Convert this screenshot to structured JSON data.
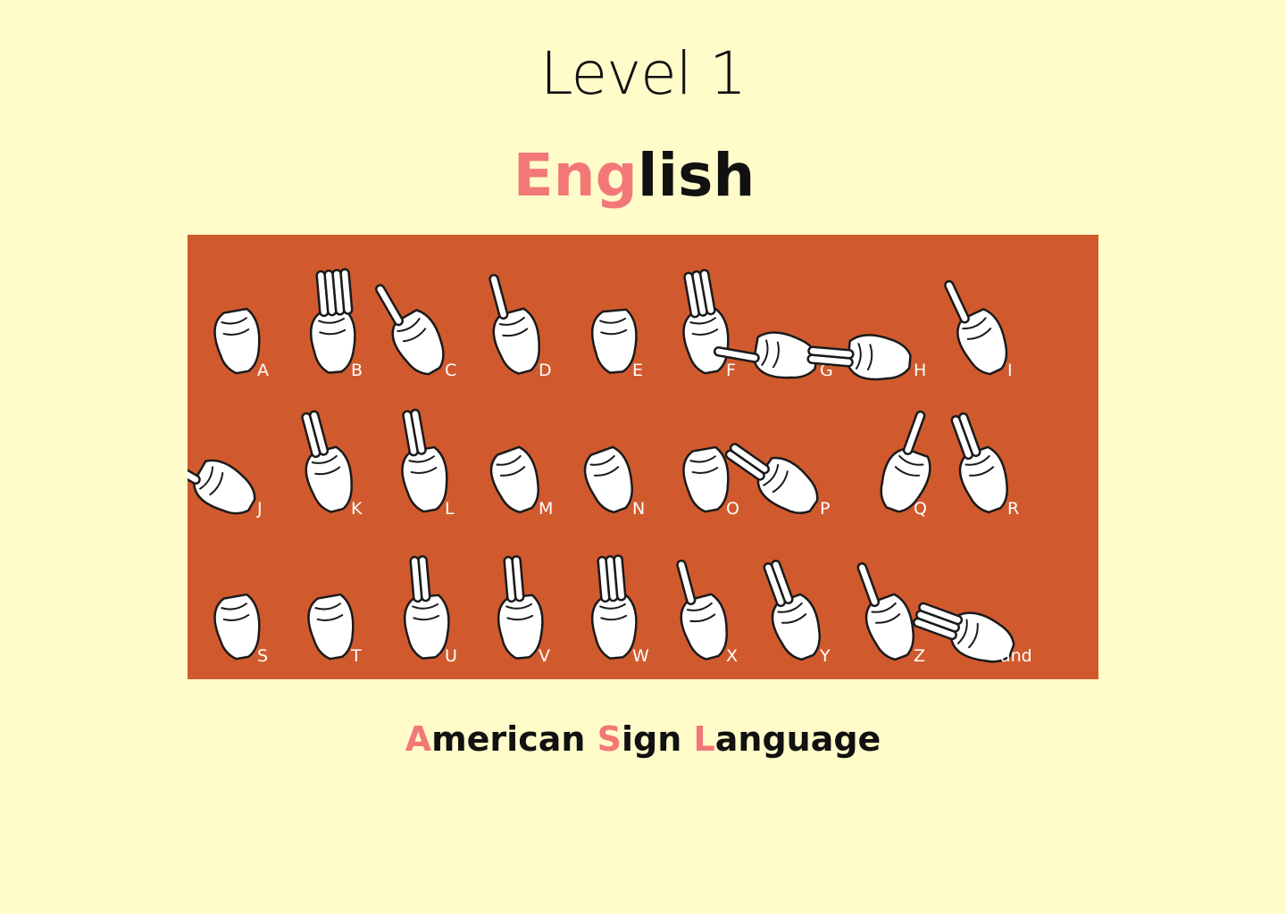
{
  "page": {
    "level_title": "Level 1",
    "language": {
      "accent": "Eng",
      "rest": "lish"
    },
    "footer": [
      {
        "accent": "A",
        "rest": "merican "
      },
      {
        "accent": "S",
        "rest": "ign "
      },
      {
        "accent": "L",
        "rest": "anguage"
      }
    ]
  },
  "colors": {
    "background": "#FFFCCA",
    "accent": "#F27878",
    "chart_bg": "#D05A2E",
    "text": "#111111"
  },
  "alphabet": [
    [
      "A",
      "B",
      "C",
      "D",
      "E",
      "F",
      "G",
      "H",
      "I"
    ],
    [
      "J",
      "K",
      "L",
      "M",
      "N",
      "O",
      "P",
      "Q",
      "R"
    ],
    [
      "S",
      "T",
      "U",
      "V",
      "W",
      "X",
      "Y",
      "Z",
      "and"
    ]
  ]
}
